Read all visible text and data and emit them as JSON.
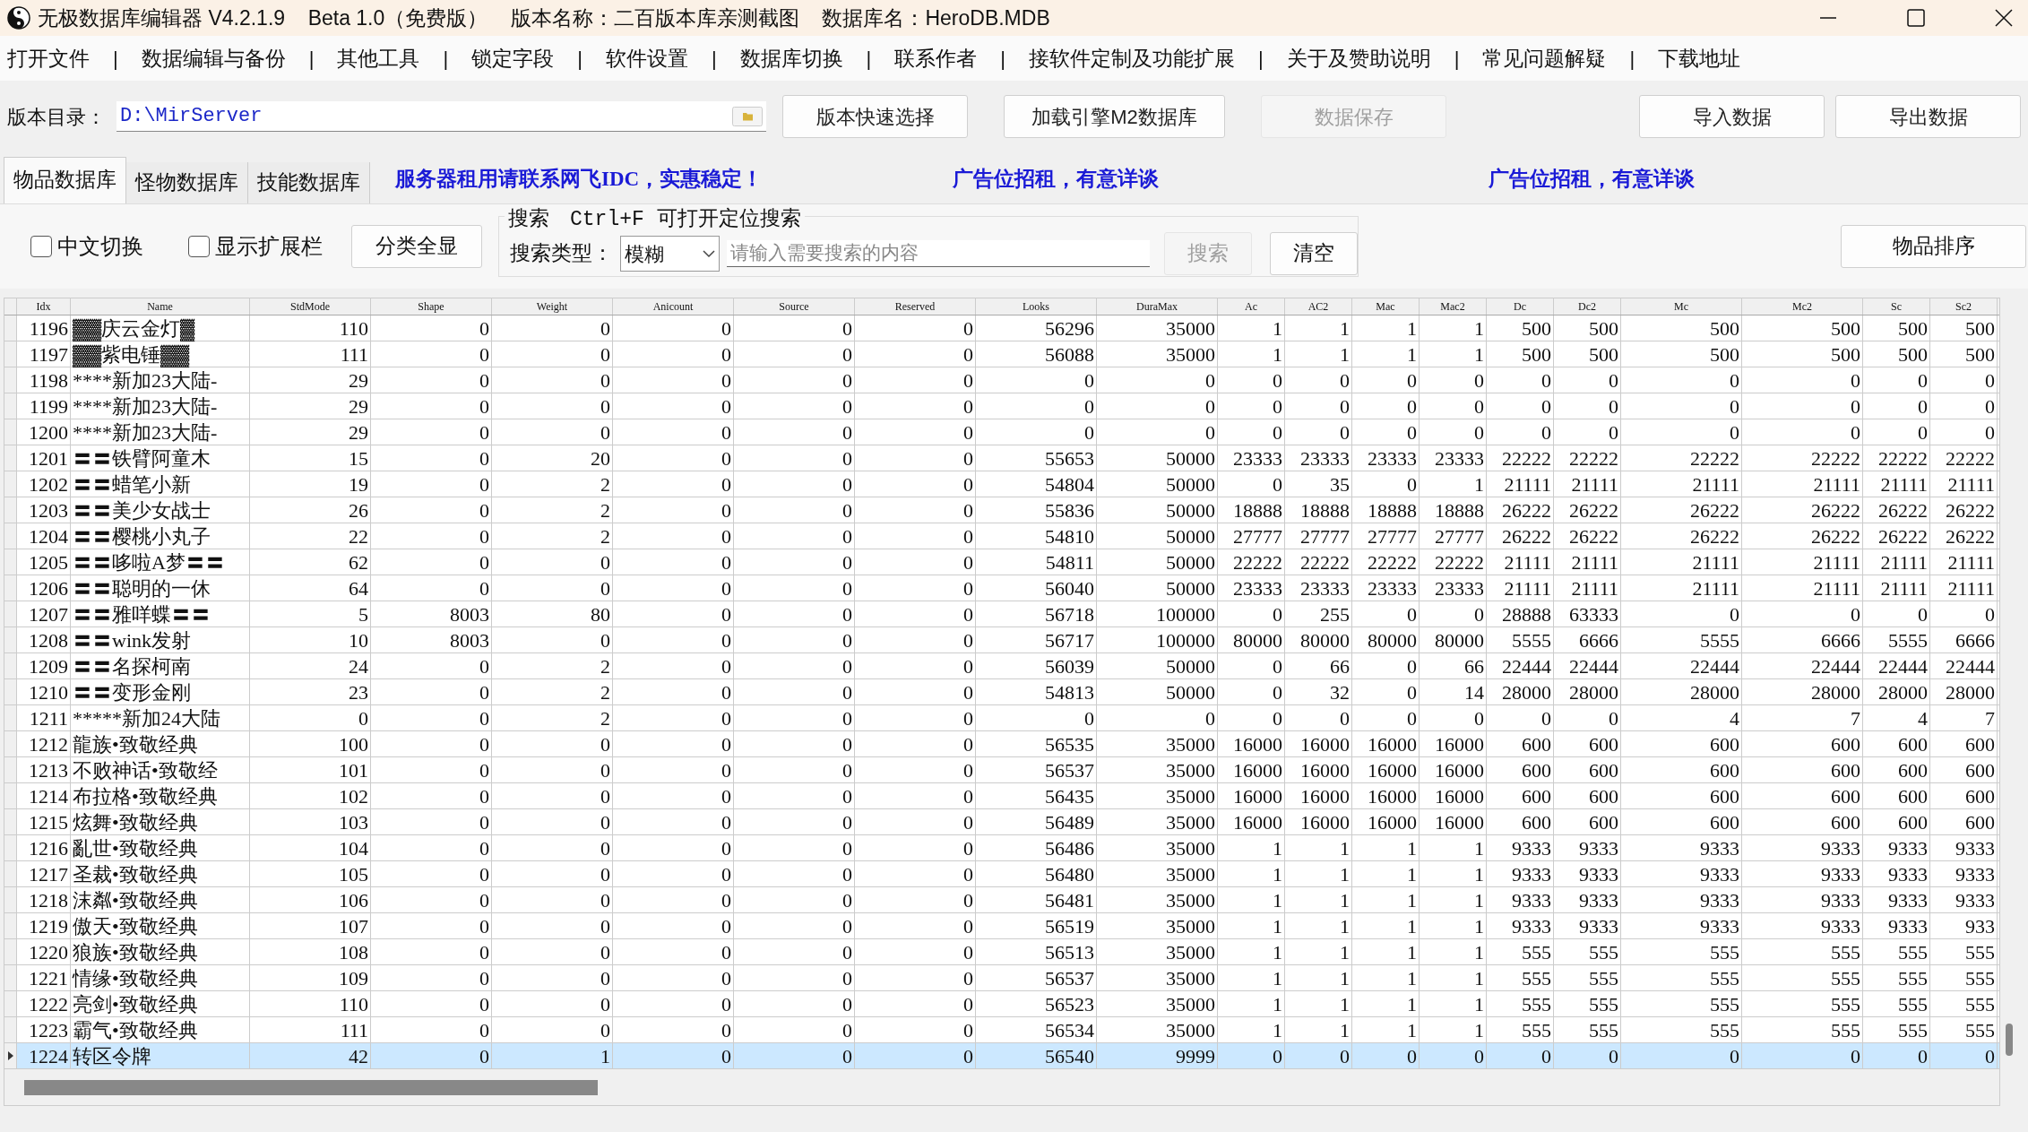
{
  "title_bar": {
    "title": "无极数据库编辑器 V4.2.1.9    Beta 1.0（免费版）    版本名称：二百版本库亲测截图    数据库名：HeroDB.MDB"
  },
  "menu": [
    "打开文件",
    "数据编辑与备份",
    "其他工具",
    "锁定字段",
    "软件设置",
    "数据库切换",
    "联系作者",
    "接软件定制及功能扩展",
    "关于及赞助说明",
    "常见问题解疑",
    "下载地址"
  ],
  "menu_separator": "|",
  "toolbar": {
    "dir_label": "版本目录：",
    "dir_value": "D:\\MirServer",
    "buttons": [
      {
        "label": "版本快速选择",
        "disabled": false
      },
      {
        "label": "加载引擎M2数据库",
        "disabled": false
      },
      {
        "label": "数据保存",
        "disabled": true
      },
      {
        "label": "导入数据",
        "disabled": false
      },
      {
        "label": "导出数据",
        "disabled": false
      }
    ]
  },
  "tabs": [
    {
      "label": "物品数据库",
      "selected": true
    },
    {
      "label": "怪物数据库",
      "selected": false
    },
    {
      "label": "技能数据库",
      "selected": false
    }
  ],
  "ads": [
    "服务器租用请联系网飞IDC，实惠稳定！",
    "广告位招租，有意详谈",
    "广告位招租，有意详谈"
  ],
  "options": {
    "checkboxes": [
      {
        "label": "中文切换",
        "checked": false
      },
      {
        "label": "显示扩展栏",
        "checked": false
      }
    ],
    "show_all": "分类全显"
  },
  "search": {
    "group_label": "搜索　Ctrl+F 可打开定位搜索",
    "type_label": "搜索类型：",
    "type_value": "模糊",
    "placeholder": "请输入需要搜索的内容",
    "search_button": {
      "label": "搜索",
      "disabled": true
    },
    "clear_button": "清空"
  },
  "sort_button": "物品排序",
  "table": {
    "columns": [
      "Idx",
      "Name",
      "StdMode",
      "Shape",
      "Weight",
      "Anicount",
      "Source",
      "Reserved",
      "Looks",
      "DuraMax",
      "Ac",
      "AC2",
      "Mac",
      "Mac2",
      "Dc",
      "Dc2",
      "Mc",
      "Mc2",
      "Sc",
      "Sc2"
    ],
    "rows": [
      {
        "selected": false,
        "cells": [
          "1196",
          "▓▓庆云金灯▓",
          "110",
          "0",
          "0",
          "0",
          "0",
          "0",
          "56296",
          "35000",
          "1",
          "1",
          "1",
          "1",
          "500",
          "500",
          "500",
          "500",
          "500",
          "500"
        ]
      },
      {
        "selected": false,
        "cells": [
          "1197",
          "▓▓紫电锤▓▓",
          "111",
          "0",
          "0",
          "0",
          "0",
          "0",
          "56088",
          "35000",
          "1",
          "1",
          "1",
          "1",
          "500",
          "500",
          "500",
          "500",
          "500",
          "500"
        ]
      },
      {
        "selected": false,
        "cells": [
          "1198",
          "****新加23大陆-",
          "29",
          "0",
          "0",
          "0",
          "0",
          "0",
          "0",
          "0",
          "0",
          "0",
          "0",
          "0",
          "0",
          "0",
          "0",
          "0",
          "0",
          "0"
        ]
      },
      {
        "selected": false,
        "cells": [
          "1199",
          "****新加23大陆-",
          "29",
          "0",
          "0",
          "0",
          "0",
          "0",
          "0",
          "0",
          "0",
          "0",
          "0",
          "0",
          "0",
          "0",
          "0",
          "0",
          "0",
          "0"
        ]
      },
      {
        "selected": false,
        "cells": [
          "1200",
          "****新加23大陆-",
          "29",
          "0",
          "0",
          "0",
          "0",
          "0",
          "0",
          "0",
          "0",
          "0",
          "0",
          "0",
          "0",
          "0",
          "0",
          "0",
          "0",
          "0"
        ]
      },
      {
        "selected": false,
        "cells": [
          "1201",
          "〓〓铁臂阿童木",
          "15",
          "0",
          "20",
          "0",
          "0",
          "0",
          "55653",
          "50000",
          "23333",
          "23333",
          "23333",
          "23333",
          "22222",
          "22222",
          "22222",
          "22222",
          "22222",
          "22222"
        ]
      },
      {
        "selected": false,
        "cells": [
          "1202",
          "〓〓蜡笔小新",
          "19",
          "0",
          "2",
          "0",
          "0",
          "0",
          "54804",
          "50000",
          "0",
          "35",
          "0",
          "1",
          "21111",
          "21111",
          "21111",
          "21111",
          "21111",
          "21111"
        ]
      },
      {
        "selected": false,
        "cells": [
          "1203",
          "〓〓美少女战士",
          "26",
          "0",
          "2",
          "0",
          "0",
          "0",
          "55836",
          "50000",
          "18888",
          "18888",
          "18888",
          "18888",
          "26222",
          "26222",
          "26222",
          "26222",
          "26222",
          "26222"
        ]
      },
      {
        "selected": false,
        "cells": [
          "1204",
          "〓〓樱桃小丸子",
          "22",
          "0",
          "2",
          "0",
          "0",
          "0",
          "54810",
          "50000",
          "27777",
          "27777",
          "27777",
          "27777",
          "26222",
          "26222",
          "26222",
          "26222",
          "26222",
          "26222"
        ]
      },
      {
        "selected": false,
        "cells": [
          "1205",
          "〓〓哆啦A梦〓〓",
          "62",
          "0",
          "0",
          "0",
          "0",
          "0",
          "54811",
          "50000",
          "22222",
          "22222",
          "22222",
          "22222",
          "21111",
          "21111",
          "21111",
          "21111",
          "21111",
          "21111"
        ]
      },
      {
        "selected": false,
        "cells": [
          "1206",
          "〓〓聪明的一休",
          "64",
          "0",
          "0",
          "0",
          "0",
          "0",
          "56040",
          "50000",
          "23333",
          "23333",
          "23333",
          "23333",
          "21111",
          "21111",
          "21111",
          "21111",
          "21111",
          "21111"
        ]
      },
      {
        "selected": false,
        "cells": [
          "1207",
          "〓〓雅咩蝶〓〓",
          "5",
          "8003",
          "80",
          "0",
          "0",
          "0",
          "56718",
          "100000",
          "0",
          "255",
          "0",
          "0",
          "28888",
          "63333",
          "0",
          "0",
          "0",
          "0"
        ]
      },
      {
        "selected": false,
        "cells": [
          "1208",
          "〓〓wink发射",
          "10",
          "8003",
          "0",
          "0",
          "0",
          "0",
          "56717",
          "100000",
          "80000",
          "80000",
          "80000",
          "80000",
          "5555",
          "6666",
          "5555",
          "6666",
          "5555",
          "6666"
        ]
      },
      {
        "selected": false,
        "cells": [
          "1209",
          "〓〓名探柯南",
          "24",
          "0",
          "2",
          "0",
          "0",
          "0",
          "56039",
          "50000",
          "0",
          "66",
          "0",
          "66",
          "22444",
          "22444",
          "22444",
          "22444",
          "22444",
          "22444"
        ]
      },
      {
        "selected": false,
        "cells": [
          "1210",
          "〓〓变形金刚",
          "23",
          "0",
          "2",
          "0",
          "0",
          "0",
          "54813",
          "50000",
          "0",
          "32",
          "0",
          "14",
          "28000",
          "28000",
          "28000",
          "28000",
          "28000",
          "28000"
        ]
      },
      {
        "selected": false,
        "cells": [
          "1211",
          "*****新加24大陆",
          "0",
          "0",
          "2",
          "0",
          "0",
          "0",
          "0",
          "0",
          "0",
          "0",
          "0",
          "0",
          "0",
          "0",
          "4",
          "7",
          "4",
          "7"
        ]
      },
      {
        "selected": false,
        "cells": [
          "1212",
          "龍族•致敬经典",
          "100",
          "0",
          "0",
          "0",
          "0",
          "0",
          "56535",
          "35000",
          "16000",
          "16000",
          "16000",
          "16000",
          "600",
          "600",
          "600",
          "600",
          "600",
          "600"
        ]
      },
      {
        "selected": false,
        "cells": [
          "1213",
          "不败神话•致敬经",
          "101",
          "0",
          "0",
          "0",
          "0",
          "0",
          "56537",
          "35000",
          "16000",
          "16000",
          "16000",
          "16000",
          "600",
          "600",
          "600",
          "600",
          "600",
          "600"
        ]
      },
      {
        "selected": false,
        "cells": [
          "1214",
          "布拉格•致敬经典",
          "102",
          "0",
          "0",
          "0",
          "0",
          "0",
          "56435",
          "35000",
          "16000",
          "16000",
          "16000",
          "16000",
          "600",
          "600",
          "600",
          "600",
          "600",
          "600"
        ]
      },
      {
        "selected": false,
        "cells": [
          "1215",
          "炫舞•致敬经典",
          "103",
          "0",
          "0",
          "0",
          "0",
          "0",
          "56489",
          "35000",
          "16000",
          "16000",
          "16000",
          "16000",
          "600",
          "600",
          "600",
          "600",
          "600",
          "600"
        ]
      },
      {
        "selected": false,
        "cells": [
          "1216",
          "亂世•致敬经典",
          "104",
          "0",
          "0",
          "0",
          "0",
          "0",
          "56486",
          "35000",
          "1",
          "1",
          "1",
          "1",
          "9333",
          "9333",
          "9333",
          "9333",
          "9333",
          "9333"
        ]
      },
      {
        "selected": false,
        "cells": [
          "1217",
          "圣裁•致敬经典",
          "105",
          "0",
          "0",
          "0",
          "0",
          "0",
          "56480",
          "35000",
          "1",
          "1",
          "1",
          "1",
          "9333",
          "9333",
          "9333",
          "9333",
          "9333",
          "9333"
        ]
      },
      {
        "selected": false,
        "cells": [
          "1218",
          "沫粼•致敬经典",
          "106",
          "0",
          "0",
          "0",
          "0",
          "0",
          "56481",
          "35000",
          "1",
          "1",
          "1",
          "1",
          "9333",
          "9333",
          "9333",
          "9333",
          "9333",
          "9333"
        ]
      },
      {
        "selected": false,
        "cells": [
          "1219",
          "傲天•致敬经典",
          "107",
          "0",
          "0",
          "0",
          "0",
          "0",
          "56519",
          "35000",
          "1",
          "1",
          "1",
          "1",
          "9333",
          "9333",
          "9333",
          "9333",
          "9333",
          "933"
        ]
      },
      {
        "selected": false,
        "cells": [
          "1220",
          "狼族•致敬经典",
          "108",
          "0",
          "0",
          "0",
          "0",
          "0",
          "56513",
          "35000",
          "1",
          "1",
          "1",
          "1",
          "555",
          "555",
          "555",
          "555",
          "555",
          "555"
        ]
      },
      {
        "selected": false,
        "cells": [
          "1221",
          "情缘•致敬经典",
          "109",
          "0",
          "0",
          "0",
          "0",
          "0",
          "56537",
          "35000",
          "1",
          "1",
          "1",
          "1",
          "555",
          "555",
          "555",
          "555",
          "555",
          "555"
        ]
      },
      {
        "selected": false,
        "cells": [
          "1222",
          "亮剑•致敬经典",
          "110",
          "0",
          "0",
          "0",
          "0",
          "0",
          "56523",
          "35000",
          "1",
          "1",
          "1",
          "1",
          "555",
          "555",
          "555",
          "555",
          "555",
          "555"
        ]
      },
      {
        "selected": false,
        "cells": [
          "1223",
          "霸气•致敬经典",
          "111",
          "0",
          "0",
          "0",
          "0",
          "0",
          "56534",
          "35000",
          "1",
          "1",
          "1",
          "1",
          "555",
          "555",
          "555",
          "555",
          "555",
          "555"
        ]
      },
      {
        "selected": true,
        "cells": [
          "1224",
          "转区令牌",
          "42",
          "0",
          "1",
          "0",
          "0",
          "0",
          "56540",
          "9999",
          "0",
          "0",
          "0",
          "0",
          "0",
          "0",
          "0",
          "0",
          "0",
          "0"
        ]
      }
    ]
  }
}
